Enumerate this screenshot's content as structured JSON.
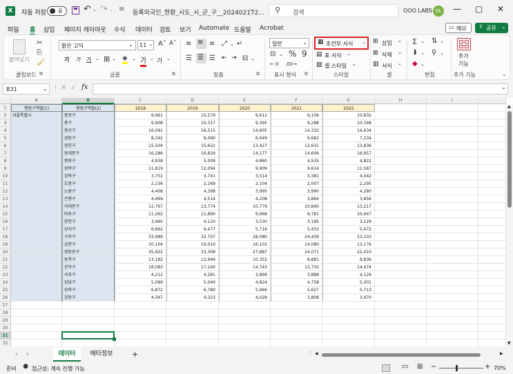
{
  "titlebar": {
    "app_icon": "X",
    "autosave_label": "자동 저장",
    "autosave_state": "끔",
    "filename": "등록외국인_현황_시도_시_군_구__202402172...",
    "search_placeholder": "검색",
    "user_name": "OOO LABS",
    "user_initials": "OL"
  },
  "menu": {
    "items": [
      "파일",
      "홈",
      "삽입",
      "페이지 레이아웃",
      "수식",
      "데이터",
      "검토",
      "보기",
      "Automate",
      "도움말",
      "Acrobat"
    ],
    "active": "홈",
    "memo_label": "메모",
    "share_label": "공유"
  },
  "ribbon": {
    "paste_label": "붙여넣기",
    "clipboard_group": "클립보드",
    "font_name": "맑은 고딕",
    "font_size": "11",
    "font_group": "글꼴",
    "align_group": "맞춤",
    "number_format": "일반",
    "number_group": "표시 형식",
    "cond_format": "조건부 서식",
    "table_format": "표 서식",
    "cell_style": "셀 스타일",
    "style_group": "스타일",
    "insert": "삽입",
    "delete": "삭제",
    "format": "서식",
    "cells_group": "셀",
    "edit_group": "편집",
    "addin_label1": "추가",
    "addin_label2": "기능",
    "addin_group": "추가 기능",
    "bold": "가",
    "italic": "가",
    "underline": "가",
    "font_color_glyph": "가",
    "style_glyph": "가"
  },
  "formula": {
    "namebox": "B31",
    "fx": "fx",
    "cancel": "✕",
    "enter": "✓"
  },
  "sheet": {
    "columns": [
      "A",
      "B",
      "C",
      "D",
      "E",
      "F",
      "G",
      "H",
      "I"
    ],
    "header_a": "행정구역별(1)",
    "header_b": "행정구역별(2)",
    "years": [
      "2018",
      "2019",
      "2020",
      "2021",
      "2022"
    ],
    "city": "서울특별시",
    "rows": [
      [
        "종로구",
        "9,961",
        "10,579",
        "9,612",
        "9,106",
        "10,832"
      ],
      [
        "중구",
        "9,908",
        "10,317",
        "9,395",
        "9,288",
        "10,348"
      ],
      [
        "용산구",
        "16,091",
        "16,515",
        "14,605",
        "14,332",
        "14,634"
      ],
      [
        "성동구",
        "8,242",
        "8,090",
        "6,949",
        "6,682",
        "7,234"
      ],
      [
        "광진구",
        "15,504",
        "15,622",
        "13,427",
        "12,631",
        "13,836"
      ],
      [
        "동대문구",
        "16,286",
        "16,829",
        "14,177",
        "14,606",
        "16,957"
      ],
      [
        "중랑구",
        "4,938",
        "5,009",
        "4,860",
        "4,535",
        "4,822"
      ],
      [
        "성북구",
        "11,819",
        "12,094",
        "9,909",
        "9,614",
        "11,587"
      ],
      [
        "강북구",
        "3,751",
        "3,741",
        "3,514",
        "3,381",
        "4,042"
      ],
      [
        "도봉구",
        "2,236",
        "2,269",
        "2,104",
        "2,007",
        "2,295"
      ],
      [
        "노원구",
        "4,408",
        "4,398",
        "3,995",
        "3,990",
        "4,280"
      ],
      [
        "은평구",
        "4,469",
        "4,514",
        "4,208",
        "3,866",
        "3,856"
      ],
      [
        "서대문구",
        "12,767",
        "13,774",
        "10,779",
        "10,840",
        "13,217"
      ],
      [
        "마포구",
        "11,262",
        "11,890",
        "9,968",
        "9,781",
        "10,947"
      ],
      [
        "양천구",
        "3,960",
        "4,120",
        "3,530",
        "3,185",
        "3,129"
      ],
      [
        "강서구",
        "6,662",
        "6,477",
        "5,716",
        "5,453",
        "5,472"
      ],
      [
        "구로구",
        "33,989",
        "32,707",
        "28,080",
        "24,409",
        "23,103"
      ],
      [
        "금천구",
        "20,104",
        "19,010",
        "16,102",
        "14,080",
        "13,176"
      ],
      [
        "영등포구",
        "35,922",
        "33,308",
        "27,887",
        "24,071",
        "22,410"
      ],
      [
        "동작구",
        "13,182",
        "12,949",
        "10,352",
        "8,881",
        "9,836"
      ],
      [
        "관악구",
        "18,083",
        "17,240",
        "14,743",
        "13,750",
        "14,474"
      ],
      [
        "서초구",
        "4,212",
        "4,281",
        "3,899",
        "3,888",
        "4,126"
      ],
      [
        "강남구",
        "5,089",
        "5,040",
        "4,824",
        "4,758",
        "5,001"
      ],
      [
        "송파구",
        "6,872",
        "6,780",
        "5,966",
        "5,627",
        "5,713"
      ],
      [
        "강동구",
        "4,347",
        "4,323",
        "4,028",
        "3,808",
        "3,970"
      ]
    ],
    "row_numbers": [
      "1",
      "2",
      "3",
      "4",
      "5",
      "6",
      "7",
      "8",
      "9",
      "10",
      "11",
      "12",
      "13",
      "14",
      "15",
      "16",
      "17",
      "18",
      "19",
      "20",
      "21",
      "22",
      "23",
      "24",
      "25",
      "26",
      "27",
      "28",
      "29",
      "30",
      "31",
      "32"
    ]
  },
  "tabs": {
    "items": [
      "데이터",
      "메타정보"
    ],
    "active": "데이터",
    "add": "+"
  },
  "status": {
    "ready": "준비",
    "accessibility": "접근성: 계속 진행 가능",
    "zoom": "70%"
  },
  "colors": {
    "excel_green": "#107c41",
    "highlight_red": "#e02020",
    "year_header": "#fff2cc",
    "region_fill": "#dce6f1"
  }
}
